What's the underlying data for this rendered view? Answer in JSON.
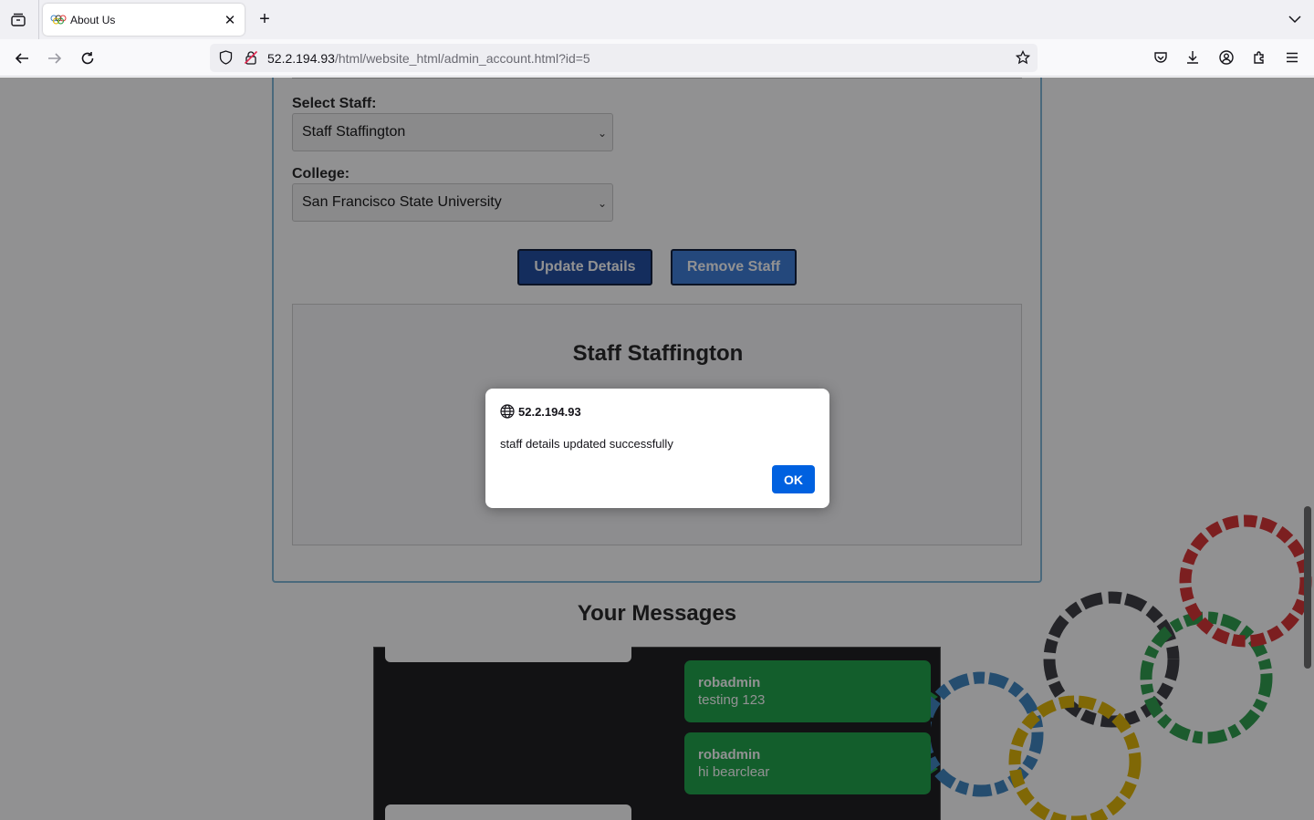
{
  "browser": {
    "tab_title": "About Us",
    "url_host": "52.2.194.93",
    "url_path": "/html/website_html/admin_account.html?id=5"
  },
  "form": {
    "staff_label": "Select Staff:",
    "staff_selected": "Staff Staffington",
    "college_label": "College:",
    "college_selected": "San Francisco State University",
    "update_button": "Update Details",
    "remove_button": "Remove Staff"
  },
  "profile": {
    "name": "Staff Staffington"
  },
  "messages": {
    "title": "Your Messages",
    "items": [
      {
        "user": "robadmin",
        "text": "testing 123"
      },
      {
        "user": "robadmin",
        "text": "hi bearclear"
      }
    ]
  },
  "dialog": {
    "origin": "52.2.194.93",
    "message": "staff details updated successfully",
    "ok_label": "OK"
  },
  "colors": {
    "accent_blue": "#0061e0",
    "message_green": "#1aa346",
    "update_button": "#1d4a9e",
    "remove_button": "#3a7ad8"
  }
}
